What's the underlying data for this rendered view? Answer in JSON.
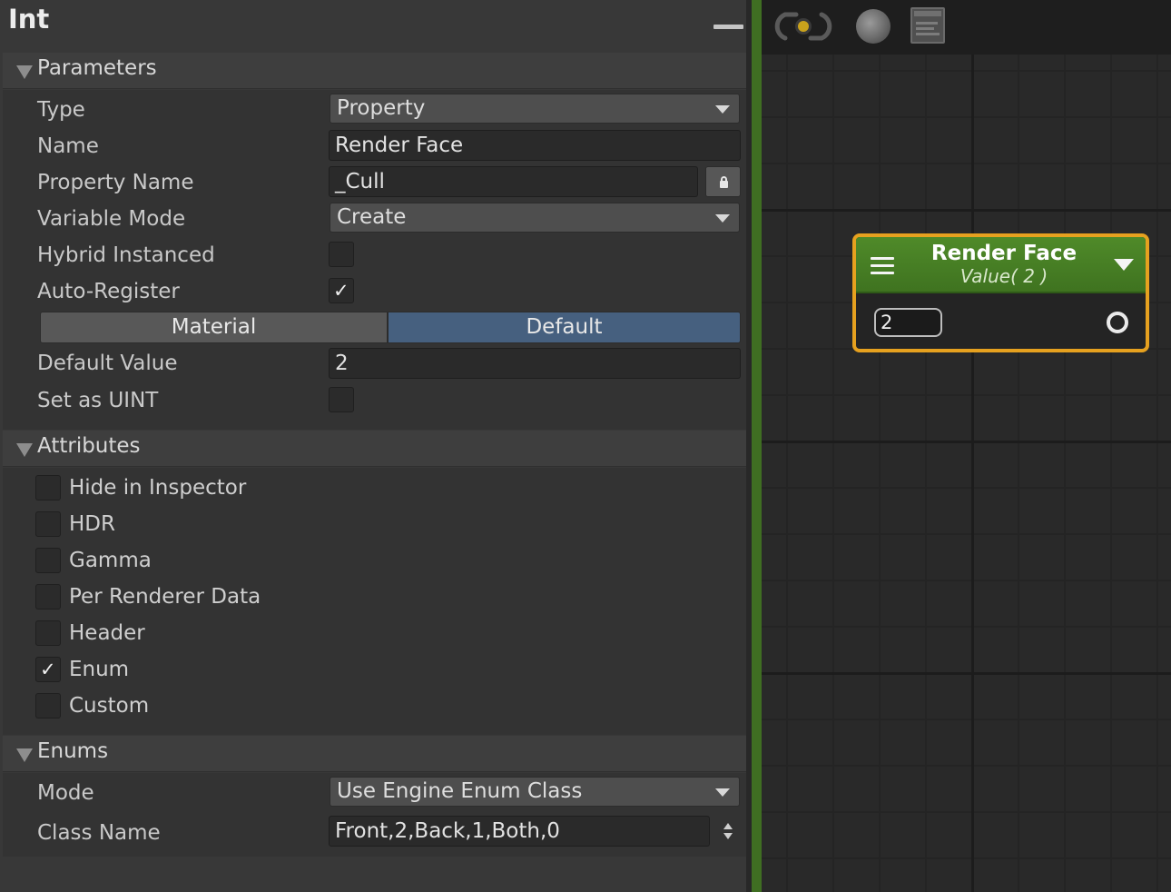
{
  "inspector": {
    "title": "Int",
    "sections": {
      "parameters": "Parameters",
      "attributes": "Attributes",
      "enums": "Enums"
    },
    "parameters": {
      "type_label": "Type",
      "type_value": "Property",
      "name_label": "Name",
      "name_value": "Render Face",
      "property_name_label": "Property Name",
      "property_name_value": "_Cull",
      "variable_mode_label": "Variable Mode",
      "variable_mode_value": "Create",
      "hybrid_instanced_label": "Hybrid Instanced",
      "hybrid_instanced_checked": false,
      "auto_register_label": "Auto-Register",
      "auto_register_checked": true,
      "tabs": [
        "Material",
        "Default"
      ],
      "selected_tab": "Default",
      "default_value_label": "Default Value",
      "default_value": "2",
      "set_as_uint_label": "Set as UINT",
      "set_as_uint_checked": false
    },
    "attributes": [
      {
        "label": "Hide in Inspector",
        "checked": false
      },
      {
        "label": "HDR",
        "checked": false
      },
      {
        "label": "Gamma",
        "checked": false
      },
      {
        "label": "Per Renderer Data",
        "checked": false
      },
      {
        "label": "Header",
        "checked": false
      },
      {
        "label": "Enum",
        "checked": true
      },
      {
        "label": "Custom",
        "checked": false
      }
    ],
    "enums": {
      "mode_label": "Mode",
      "mode_value": "Use Engine Enum Class",
      "class_name_label": "Class Name",
      "class_name_value": "Front,2,Back,1,Both,0"
    }
  },
  "canvas": {
    "toolbar_icons": [
      "live-preview-icon",
      "sphere-preview-icon",
      "window-icon"
    ],
    "node": {
      "title": "Render Face",
      "subtitle": "Value( 2 )",
      "input_value": "2",
      "header_color": "#4a8526",
      "border_color": "#e6a11f"
    }
  },
  "check_glyph": "✓",
  "colors": {
    "selected_tab": "#46607f",
    "accent_green": "#3f6e22"
  }
}
